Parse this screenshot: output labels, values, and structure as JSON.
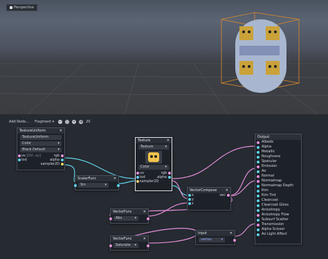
{
  "viewport": {
    "label": "Perspective"
  },
  "toolbar": {
    "add_node": "Add Node...",
    "mode": "Fragment",
    "mode_arrow": "▾",
    "zoom_out": "−",
    "zoom_reset": "○",
    "zoom_in": "+",
    "grid": "⊞",
    "snap_value": "20"
  },
  "nodes": {
    "texture_uniform": {
      "title": "TextureUniform",
      "close": "✕",
      "name": "TextureUniform",
      "type": "Color",
      "type_arrow": "▾",
      "default": "Black Default",
      "default_arrow": "▾",
      "in_uv": "uv",
      "in_uv_hint": "[UV, xy]",
      "in_lod": "lod",
      "out_rgb": "rgb",
      "out_alpha": "alpha",
      "out_sampler": "sampler2D"
    },
    "texture": {
      "title": "Texture",
      "close": "✕",
      "source": "Texture",
      "source_arrow": "▾",
      "type": "Color",
      "type_arrow": "▾",
      "in_uv": "uv",
      "in_lod": "lod",
      "in_sampler": "sampler2D",
      "out_rgb": "rgb",
      "out_alpha": "alpha"
    },
    "scalar_func": {
      "title": "ScalarFunc",
      "close": "✕",
      "func": "Sin",
      "func_arrow": "▾"
    },
    "vector_compose": {
      "title": "VectorCompose",
      "close": "✕",
      "in_x": "x",
      "in_y": "y",
      "in_z": "z",
      "out_vec": "vec"
    },
    "vector_func_abs": {
      "title": "VectorFunc",
      "close": "✕",
      "func": "Abs",
      "func_arrow": "▾"
    },
    "vector_func_sat": {
      "title": "VectorFunc",
      "close": "✕",
      "func": "Saturate",
      "func_arrow": "▾"
    },
    "input": {
      "title": "Input",
      "close": "✕",
      "value": "vertex",
      "value_arrow": "▾"
    },
    "output": {
      "title": "Output",
      "ports": [
        "Albedo",
        "Alpha",
        "Metallic",
        "Roughness",
        "Specular",
        "Emission",
        "Ao",
        "Normal",
        "Normalmap",
        "Normalmap Depth",
        "Rim",
        "Rim Tint",
        "Clearcoat",
        "Clearcoat Gloss",
        "Anisotropy",
        "Anisotropy Flow",
        "Subsurf Scatter",
        "Transmission",
        "Alpha Scissor",
        "Ao Light Affect"
      ]
    }
  },
  "colors": {
    "vector": "#e38ed9",
    "scalar": "#5fd3e8",
    "sampler": "#e6d46a",
    "wire_pink": "#d98ad6",
    "wire_cyan": "#49c6e0"
  }
}
